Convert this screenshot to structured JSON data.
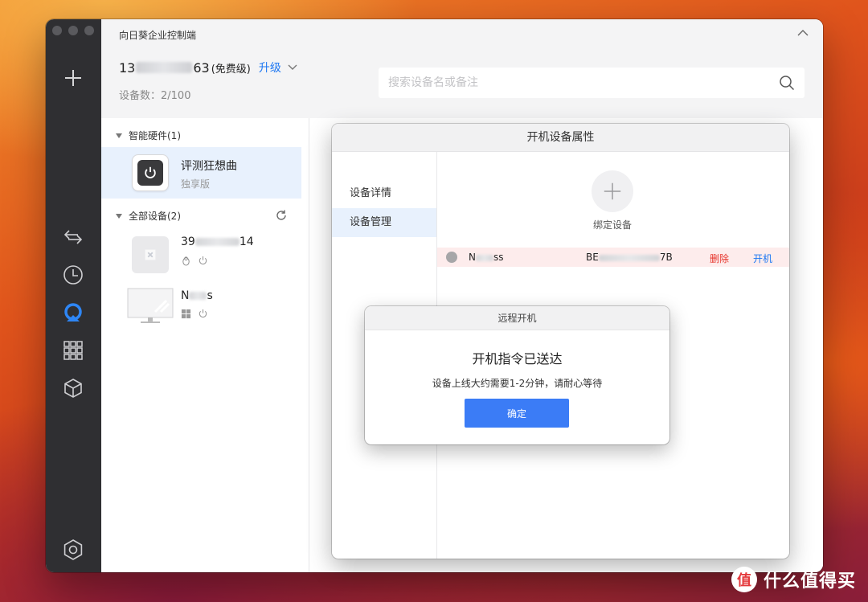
{
  "window": {
    "title": "向日葵企业控制端",
    "account": {
      "prefix": "13",
      "suffix": "63",
      "plan": "(免费级)",
      "upgrade": "升级"
    },
    "device_count": "设备数：2/100",
    "search": {
      "placeholder": "搜索设备名或备注"
    }
  },
  "sidebar": {
    "hardware_group": "智能硬件(1)",
    "hardware_item": {
      "name": "评测狂想曲",
      "sub": "独享版"
    },
    "all_group": "全部设备(2)",
    "devices": [
      {
        "name_prefix": "39",
        "name_suffix": "14",
        "os": "linux"
      },
      {
        "name_prefix": "N",
        "name_suffix": "s",
        "os": "windows"
      }
    ]
  },
  "props_dialog": {
    "title": "开机设备属性",
    "nav": [
      "设备详情",
      "设备管理"
    ],
    "bind_label": "绑定设备",
    "row": {
      "name_prefix": "N",
      "name_suffix": "ss",
      "id_prefix": "BE",
      "id_suffix": "7B",
      "delete": "删除",
      "power_on": "开机"
    }
  },
  "boot_dialog": {
    "title": "远程开机",
    "heading": "开机指令已送达",
    "message": "设备上线大约需要1-2分钟，请耐心等待",
    "ok": "确定"
  },
  "watermark": {
    "text": "什么值得买",
    "badge": "值"
  },
  "colors": {
    "accent": "#1f78f2",
    "danger": "#e6332a",
    "primary_button": "#3b7cf6",
    "rail": "#2f2f32"
  }
}
